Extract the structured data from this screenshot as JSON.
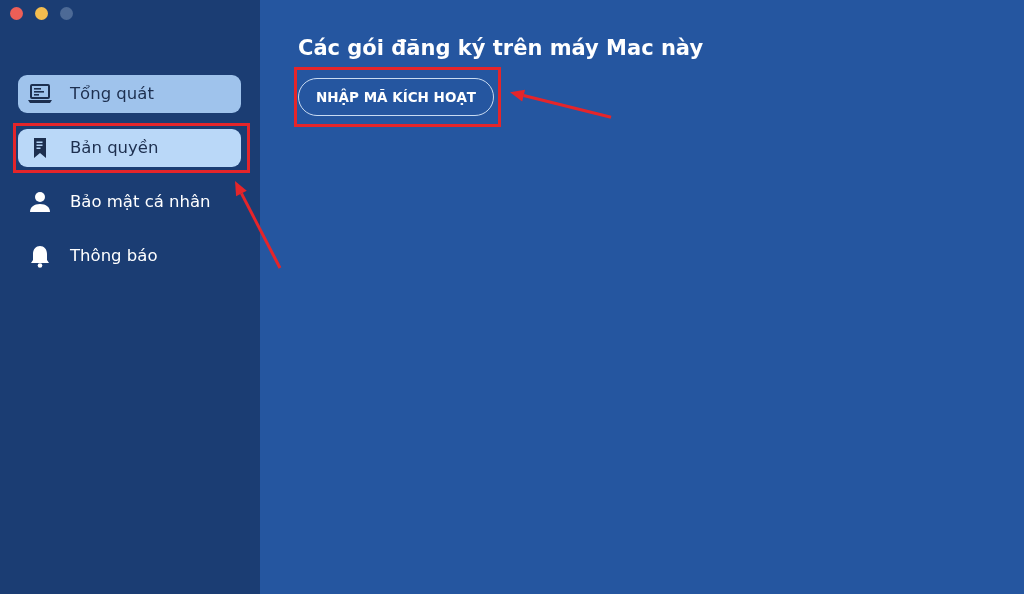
{
  "sidebar": {
    "items": [
      {
        "label": "Tổng quát",
        "selected": false,
        "highlighted": true,
        "annotated": false
      },
      {
        "label": "Bản quyền",
        "selected": true,
        "highlighted": false,
        "annotated": true
      },
      {
        "label": "Bảo mật cá nhân",
        "selected": false,
        "highlighted": false,
        "annotated": false
      },
      {
        "label": "Thông báo",
        "selected": false,
        "highlighted": false,
        "annotated": false
      }
    ]
  },
  "main": {
    "title": "Các gói đăng ký trên máy Mac này",
    "button": {
      "label": "NHẬP MÃ KÍCH HOẠT",
      "annotated": true
    }
  }
}
